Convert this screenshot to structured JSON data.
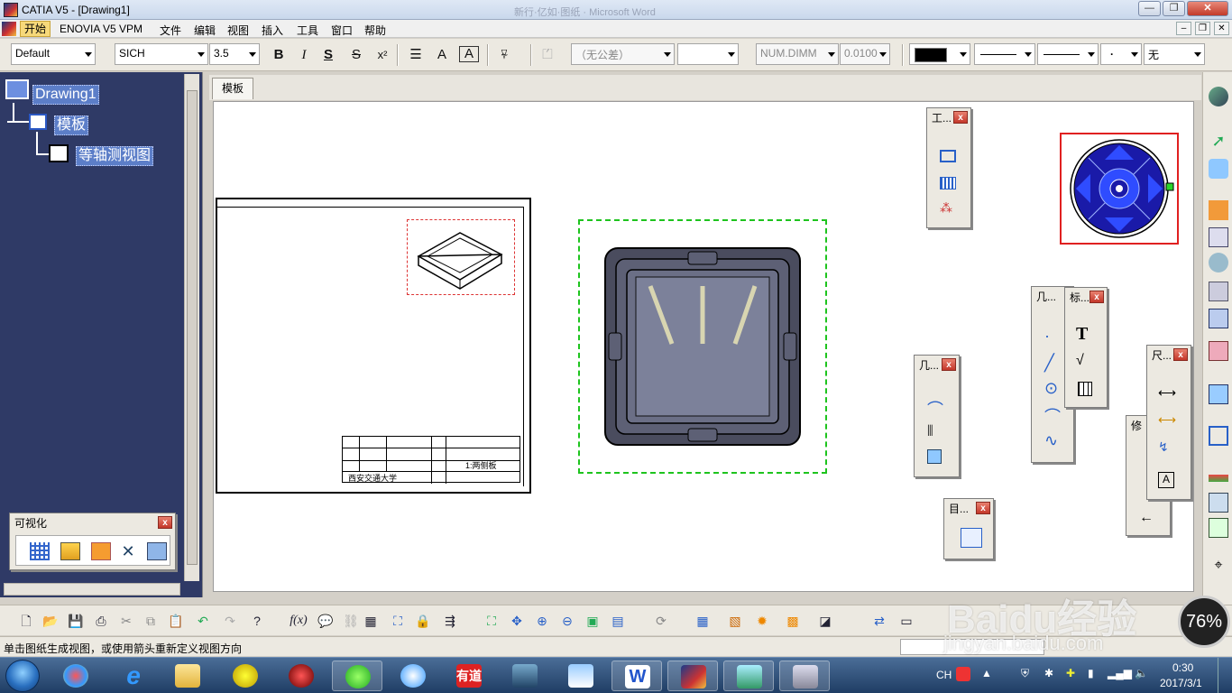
{
  "window": {
    "title": "CATIA V5 - [Drawing1]",
    "ghost_title": "新行·亿如·图纸 · Microsoft Word"
  },
  "menubar": {
    "items": [
      "开始",
      "ENOVIA V5 VPM",
      "文件",
      "编辑",
      "视图",
      "插入",
      "工具",
      "窗口",
      "帮助"
    ]
  },
  "format_toolbar": {
    "style": "Default",
    "font": "SICH",
    "font_size": "3.5",
    "tolerance": "（无公差）",
    "dim_format": "NUM.DIMM",
    "precision": "0.0100",
    "line_fill": "无",
    "colors": {
      "swatch": "#000000"
    }
  },
  "tree": {
    "root": "Drawing1",
    "sheet": "模板",
    "view": "等轴测视图"
  },
  "canvas": {
    "tab": "模板",
    "title_block_text": [
      "西安交通大学",
      "1:两侧板"
    ]
  },
  "floats": {
    "visualization": "可视化",
    "tools": "工...",
    "geometry1": "几...",
    "annotation": "标...",
    "geometry2": "几...",
    "dimension": "尺...",
    "modify": "修",
    "dress": "目..."
  },
  "status": {
    "message": "单击图纸生成视图，或使用箭头重新定义视图方向"
  },
  "taskbar": {
    "ime": "CH",
    "time": "0:30",
    "date": "2017/3/1",
    "speed_percent": "76%"
  },
  "watermark": {
    "brand": "Baidu经验",
    "url": "jingyan.baidu.com"
  }
}
